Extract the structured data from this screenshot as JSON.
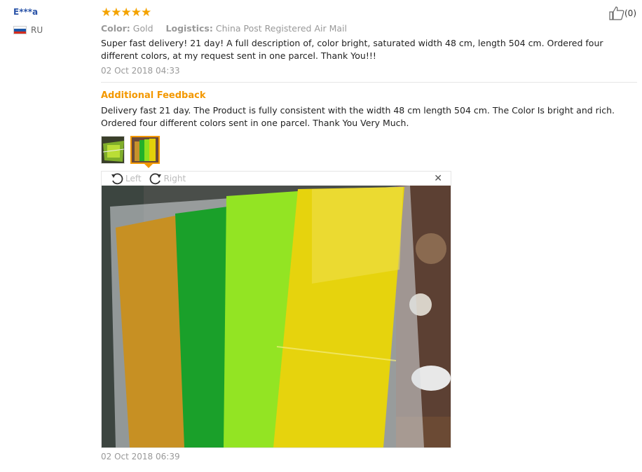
{
  "reviewer": {
    "name": "E***a",
    "country": "RU"
  },
  "review": {
    "stars": "★★★★★",
    "color_label": "Color:",
    "color_value": "Gold",
    "logistics_label": "Logistics:",
    "logistics_value": "China Post Registered Air Mail",
    "text": "Super fast delivery! 21 day! A full description of, color bright, saturated width 48 cm, length 504 cm. Ordered four different colors, at my request sent in one parcel. Thank You!!!",
    "date": "02 Oct 2018 04:33",
    "likes": "(0)"
  },
  "additional": {
    "title": "Additional Feedback",
    "text": "Delivery fast 21 day. The Product is fully consistent with the width 48 cm length 504 cm. The Color Is bright and rich. Ordered four different colors sent in one parcel. Thank You Very Much.",
    "date": "02 Oct 2018 06:39"
  },
  "viewer": {
    "rotate_left": "Left",
    "rotate_right": "Right",
    "close": "✕"
  },
  "colors": {
    "accent": "#f39800",
    "username": "#2b54a8"
  }
}
